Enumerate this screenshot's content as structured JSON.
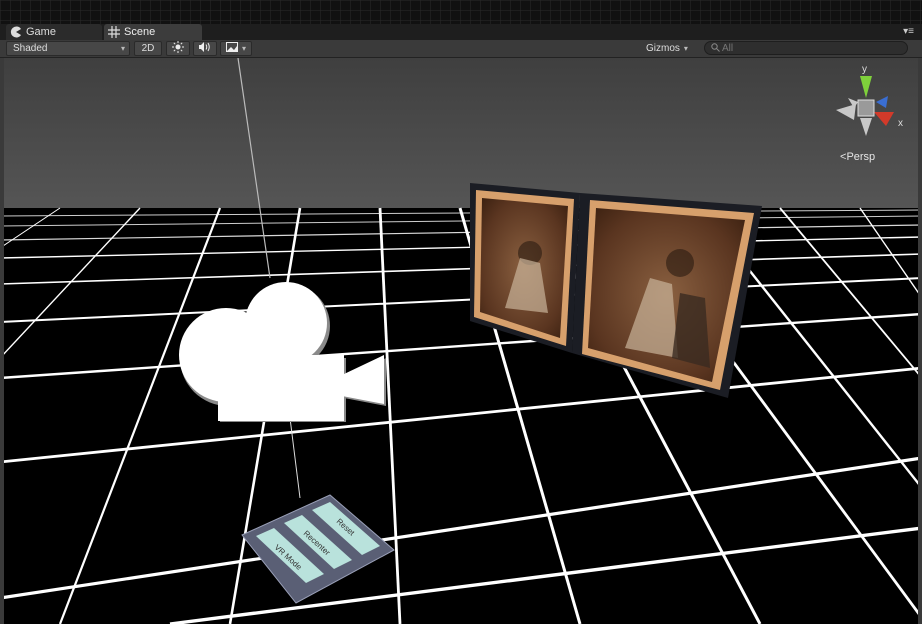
{
  "tabs": [
    {
      "label": "Game",
      "icon": "pacman-icon",
      "active": false
    },
    {
      "label": "Scene",
      "icon": "grid-icon",
      "active": true
    }
  ],
  "toolbar": {
    "shading_mode": "Shaded",
    "mode_2d": "2D",
    "lighting_icon": "sun-icon",
    "audio_icon": "speaker-icon",
    "effects_icon": "image-icon",
    "gizmos_label": "Gizmos",
    "search_placeholder": "All"
  },
  "scene_gizmo": {
    "axis_y": "y",
    "axis_x": "x",
    "projection": "Persp",
    "colors": {
      "y": "#7fd13b",
      "x": "#d23a2a",
      "z": "#3a6ed2"
    }
  },
  "ui_panel": {
    "buttons": [
      {
        "label": "Reset"
      },
      {
        "label": "Recenter"
      },
      {
        "label": "VR Mode"
      }
    ]
  },
  "colors": {
    "sky": "#4a4a4a",
    "ground": "#000000",
    "grid": "#ffffff",
    "photo": "#6b3f24"
  }
}
